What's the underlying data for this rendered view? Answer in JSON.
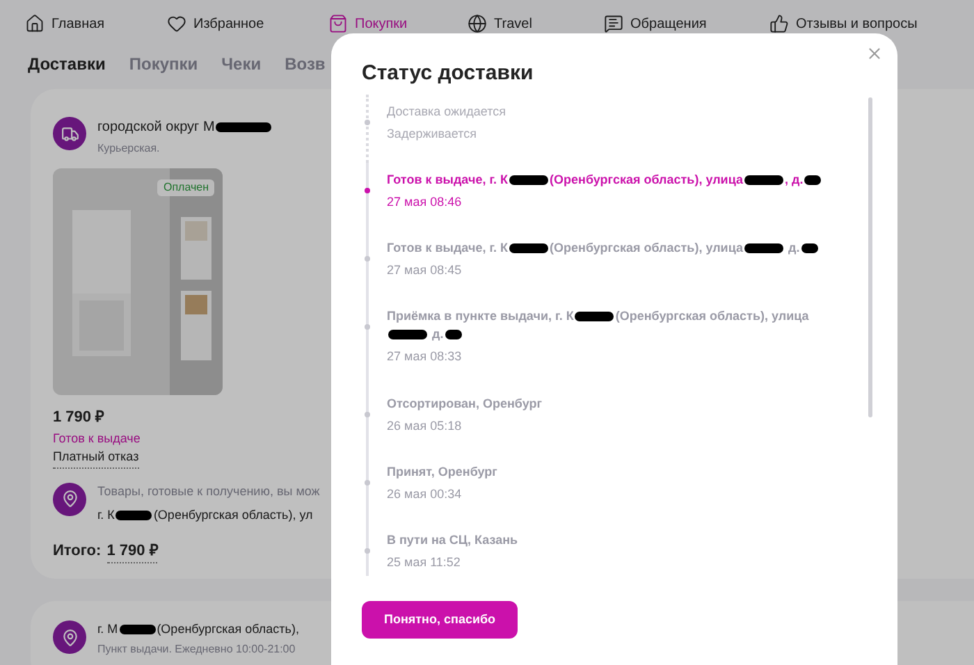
{
  "nav": [
    {
      "label": "Главная",
      "selected": false
    },
    {
      "label": "Избранное",
      "selected": false
    },
    {
      "label": "Покупки",
      "selected": true
    },
    {
      "label": "Travel",
      "selected": false
    },
    {
      "label": "Обращения",
      "selected": false
    },
    {
      "label": "Отзывы и вопросы",
      "selected": false
    }
  ],
  "tabs": [
    {
      "label": "Доставки",
      "selected": true
    },
    {
      "label": "Покупки",
      "selected": false
    },
    {
      "label": "Чеки",
      "selected": false
    },
    {
      "label": "Возв",
      "selected": false
    }
  ],
  "order": {
    "address_parts": [
      "городской округ М"
    ],
    "delivery_type": "Курьерская.",
    "badge": "Оплачен",
    "price": "1 790 ₽",
    "status": "Готов к выдаче",
    "refund": "Платный отказ",
    "pickup_note": "Товары, готовые к получению, вы мож",
    "pickup_address_parts": [
      "г. К",
      "(Оренбургская область), ул"
    ],
    "total_label": "Итого:",
    "total": "1 790 ₽"
  },
  "order_2": {
    "address_parts": [
      "г. М",
      "(Оренбургская область),"
    ],
    "hours": "Пункт выдачи. Ежедневно 10:00-21:00"
  },
  "modal": {
    "title": "Статус доставки",
    "button": "Понятно, спасибо",
    "events": [
      {
        "kind": "pending",
        "title_parts": [
          "Доставка ожидается"
        ],
        "time": "Задерживается"
      },
      {
        "kind": "current",
        "title_parts": [
          "Готов к выдаче, г. К",
          "(Оренбургская область), улица",
          ", д."
        ],
        "time": "27 мая 08:46"
      },
      {
        "kind": "past",
        "title_parts": [
          "Готов к выдаче, г. К",
          "(Оренбургская область), улица",
          " д."
        ],
        "time": "27 мая 08:45"
      },
      {
        "kind": "past",
        "title_parts": [
          "Приёмка в пункте выдачи, г. К",
          "(Оренбургская область), улица",
          " д."
        ],
        "time": "27 мая 08:33"
      },
      {
        "kind": "past",
        "title_parts": [
          "Отсортирован, Оренбург"
        ],
        "time": "26 мая 05:18"
      },
      {
        "kind": "past",
        "title_parts": [
          "Принят, Оренбург"
        ],
        "time": "26 мая 00:34"
      },
      {
        "kind": "past",
        "title_parts": [
          "В пути на СЦ, Казань"
        ],
        "time": "25 мая 11:52"
      }
    ]
  }
}
